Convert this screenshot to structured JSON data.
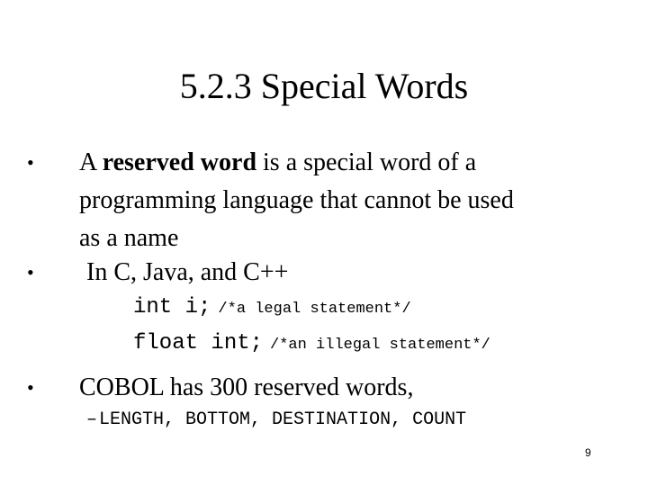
{
  "slide": {
    "title": "5.2.3 Special Words",
    "bullets": [
      {
        "marker": "•",
        "lines": [
          {
            "prefix": "A ",
            "bold": "reserved word",
            "suffix": " is a special word of a"
          },
          {
            "text": "programming language that cannot be used"
          },
          {
            "text": "as a name"
          }
        ]
      },
      {
        "marker": "•",
        "text": "In C, Java, and C++",
        "code_examples": [
          {
            "code": "int i;",
            "comment": "/*a legal statement*/"
          },
          {
            "code": "float int;",
            "comment": "/*an illegal statement*/"
          }
        ]
      },
      {
        "marker": "•",
        "text": "COBOL has 300 reserved words,",
        "sub_items": [
          {
            "dash": "–",
            "text": "LENGTH, BOTTOM, DESTINATION, COUNT"
          }
        ]
      }
    ],
    "page_number": "9"
  }
}
